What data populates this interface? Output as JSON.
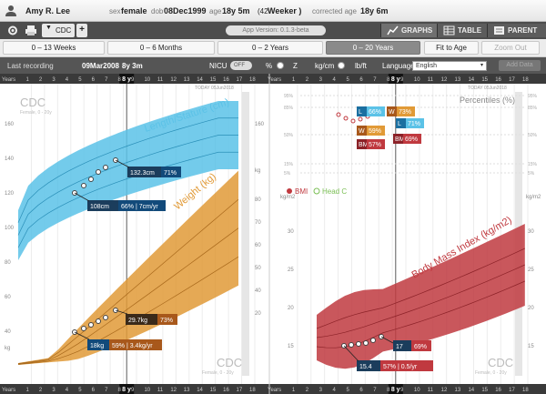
{
  "patient": {
    "name": "Amy R. Lee",
    "sex_label": "sex",
    "sex": "female",
    "dob_label": "dob",
    "dob": "08Dec1999",
    "age_label": "age",
    "age": "18y 5m",
    "weeks": "(42",
    "weeks_unit": "Weeker )",
    "corrected_label": "corrected age",
    "corrected_age": "18y 6m"
  },
  "toolbar": {
    "cdc_tab": "CDC",
    "app_version": "App Version: 0.1.3-beta",
    "graphs": "GRAPHS",
    "table": "TABLE",
    "parent": "PARENT"
  },
  "ranges": [
    {
      "label": "0 – 13 Weeks"
    },
    {
      "label": "0 – 6 Months"
    },
    {
      "label": "0 – 2 Years"
    },
    {
      "label": "0 – 20 Years",
      "active": true
    },
    {
      "label": "Fit to Age"
    },
    {
      "label": "Zoom Out",
      "disabled": true
    }
  ],
  "recording": {
    "label": "Last recording",
    "date": "09Mar2008",
    "age": "8y 3m",
    "nicu": "NICU",
    "nicu_toggle": "OFF",
    "pct": "%",
    "z": "Z",
    "kgcm": "kg/cm",
    "lbft": "lb/ft",
    "language_label": "Language:",
    "language": "English",
    "add_data": "Add Data"
  },
  "charts": {
    "left": {
      "years_label": "Years",
      "top_marker": "8 y",
      "today": "TODAY 05Jun2018",
      "x_ticks": [
        "1",
        "2",
        "3",
        "4",
        "5",
        "6",
        "7",
        "8",
        "9",
        "10",
        "11",
        "12",
        "13",
        "14",
        "15",
        "16",
        "17",
        "18"
      ],
      "title_cdc": "CDC",
      "subtitle": "Female, 0 - 20y",
      "title_cdc2": "CDC",
      "subtitle2": "Female, 0 - 20y",
      "length_title": "Length/Stature (cm)",
      "length_ticks_left": [
        "160",
        "140",
        "120",
        "100",
        "80",
        "60",
        "40"
      ],
      "length_ticks_right": [
        "160"
      ],
      "weight_title": "Weight (kg)",
      "weight_unit": "kg",
      "weight_ticks_right": [
        "80",
        "70",
        "60",
        "50",
        "40",
        "20"
      ],
      "kg_bottom": "kg",
      "callouts": {
        "length_current": "132.3cm",
        "length_current_pct": "71%",
        "length_prev": "108cm",
        "length_prev_info": "66% | 7cm/yr",
        "weight_current": "29.7kg",
        "weight_current_pct": "73%",
        "weight_prev": "18kg",
        "weight_prev_info": "59% | 3.4kg/yr"
      }
    },
    "right": {
      "years_label": "Years",
      "top_marker": "8 y",
      "today": "TODAY 05Jun2018",
      "x_ticks": [
        "1",
        "2",
        "3",
        "4",
        "5",
        "6",
        "7",
        "8",
        "9",
        "10",
        "11",
        "12",
        "13",
        "14",
        "15",
        "16",
        "17",
        "18"
      ],
      "percentiles_title": "Percentiles (%)",
      "pct_ticks": [
        "95%",
        "85%",
        "50%",
        "15%",
        "5%"
      ],
      "legend_bmi": "BMI",
      "legend_head": "Head C",
      "bmi_title": "Body Mass Index (kg/m2)",
      "bmi_unit": "kg/m2",
      "bmi_ticks_left": [
        "30",
        "25",
        "20",
        "15"
      ],
      "bmi_ticks_right": [
        "30",
        "25",
        "20",
        "15"
      ],
      "title_cdc": "CDC",
      "subtitle": "Female, 0 - 20y",
      "badges": {
        "l_label": "L",
        "l_pct": "66%",
        "w_label": "W",
        "w_pct": "73%",
        "l2_label": "L",
        "l2_pct": "71%",
        "w2_label": "W",
        "w2_pct": "59%",
        "bmi_label": "BMI",
        "bmi_pct": "57%",
        "bmi2_label": "BMI",
        "bmi2_pct": "69%"
      },
      "callouts": {
        "bmi_current": "17",
        "bmi_current_pct": "69%",
        "bmi_prev": "15.4",
        "bmi_prev_info": "57% | 0.5/yr"
      }
    }
  },
  "bottom": {
    "years_left": "Years",
    "years_right": "Years",
    "marker": "8 y"
  },
  "colors": {
    "length": "#5bc2e7",
    "weight": "#e19a37",
    "bmi": "#c0393f",
    "callout": "#124a7a",
    "toolbar": "#4d4d4d"
  }
}
